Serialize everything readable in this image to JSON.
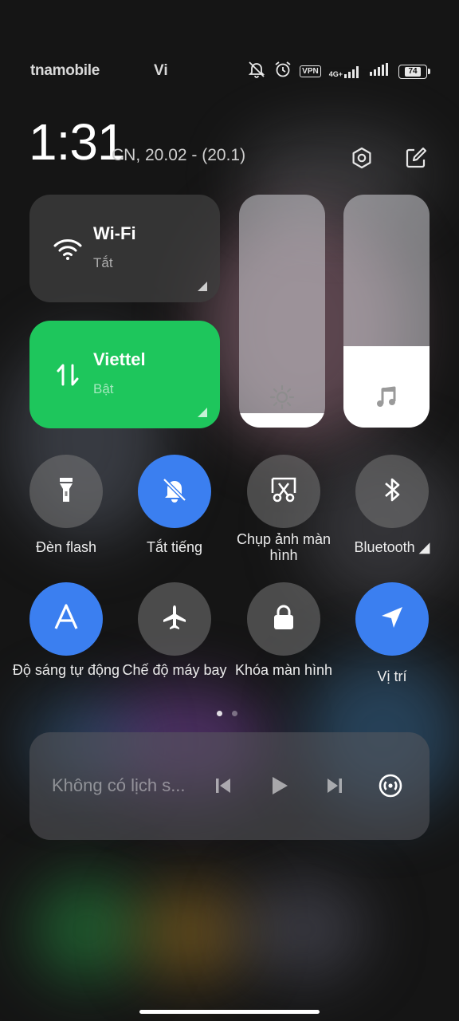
{
  "status_bar": {
    "carrier_left": "tnamobile",
    "carrier_right": "Vi",
    "vpn": "VPN",
    "network": "4G+",
    "battery": "74"
  },
  "header": {
    "time": "1:31",
    "date": "CN, 20.02 - (20.1)",
    "settings_icon": "settings-icon",
    "edit_icon": "edit-icon"
  },
  "tiles": {
    "wifi": {
      "title": "Wi-Fi",
      "status": "Tắt",
      "icon": "wifi-icon"
    },
    "mobile_data": {
      "title": "Viettel",
      "status": "Bật",
      "icon": "data-transfer-icon",
      "color": "#1ec65c"
    }
  },
  "sliders": {
    "brightness": {
      "level": 0.06,
      "icon": "brightness-icon"
    },
    "volume": {
      "level": 0.35,
      "icon": "music-note-icon"
    }
  },
  "toggles": [
    {
      "label": "Đèn flash",
      "on": false,
      "icon": "flashlight-icon"
    },
    {
      "label": "Tắt tiếng",
      "on": true,
      "icon": "bell-off-icon"
    },
    {
      "label": "Chụp ảnh màn hình",
      "on": false,
      "icon": "screenshot-icon"
    },
    {
      "label": "Bluetooth ◢",
      "on": false,
      "icon": "bluetooth-icon"
    },
    {
      "label": "Độ sáng tự động",
      "on": true,
      "icon": "auto-brightness-icon"
    },
    {
      "label": "Chế độ máy bay",
      "on": false,
      "icon": "airplane-icon"
    },
    {
      "label": "Khóa màn hình",
      "on": false,
      "icon": "lock-icon"
    },
    {
      "label": "Vị trí",
      "on": true,
      "icon": "location-icon"
    }
  ],
  "pager": {
    "pages": 2,
    "current": 1
  },
  "media": {
    "text": "Không có lịch s...",
    "buttons": [
      "previous-icon",
      "play-icon",
      "next-icon",
      "cast-icon"
    ]
  },
  "colors": {
    "accent_blue": "#3b7ff0",
    "data_green": "#1ec65c"
  }
}
